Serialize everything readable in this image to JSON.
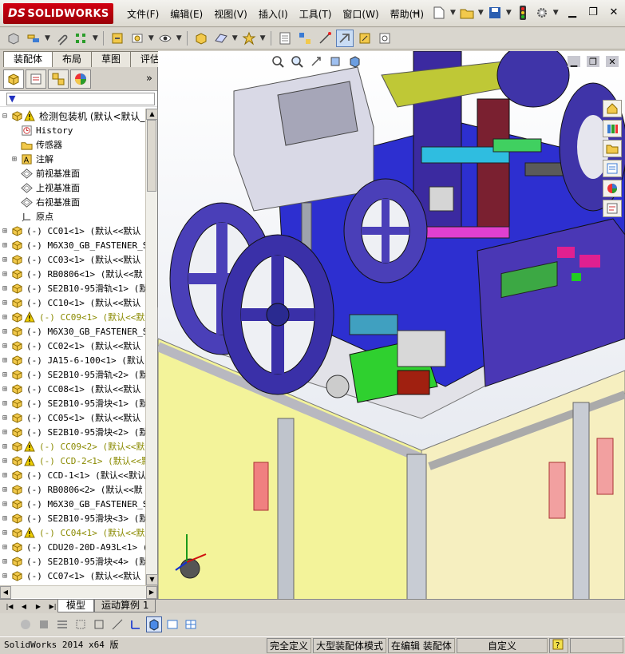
{
  "app": {
    "brand": "SOLIDWORKS",
    "brand_prefix": "DS"
  },
  "menu": {
    "items": [
      "文件(F)",
      "编辑(E)",
      "视图(V)",
      "插入(I)",
      "工具(T)",
      "窗口(W)",
      "帮助(H)"
    ],
    "pin": "⊣"
  },
  "tabs": [
    "装配体",
    "布局",
    "草图",
    "评估"
  ],
  "filter": {
    "placeholder": "▼"
  },
  "tree": {
    "root": "检测包装机  (默认<默认_显",
    "nodes": [
      {
        "label": "History",
        "icon": "history-icon"
      },
      {
        "label": "传感器",
        "icon": "sensor-icon"
      },
      {
        "label": "注解",
        "icon": "annotation-icon"
      },
      {
        "label": "前视基准面",
        "icon": "plane-icon"
      },
      {
        "label": "上视基准面",
        "icon": "plane-icon"
      },
      {
        "label": "右视基准面",
        "icon": "plane-icon"
      },
      {
        "label": "原点",
        "icon": "origin-icon"
      }
    ],
    "components": [
      {
        "label": "(-) CC01<1> (默认<<默认",
        "warn": false
      },
      {
        "label": "(-) M6X30_GB_FASTENER_S",
        "warn": false
      },
      {
        "label": "(-) CC03<1> (默认<<默认",
        "warn": false
      },
      {
        "label": "(-) RB0806<1> (默认<<默",
        "warn": false
      },
      {
        "label": "(-) SE2B10-95滑轨<1> (默",
        "warn": false
      },
      {
        "label": "(-) CC10<1> (默认<<默认",
        "warn": false
      },
      {
        "label": "(-) CC09<1> (默认<<默",
        "warn": true
      },
      {
        "label": "(-) M6X30_GB_FASTENER_S",
        "warn": false
      },
      {
        "label": "(-) CC02<1> (默认<<默认",
        "warn": false
      },
      {
        "label": "(-) JA15-6-100<1> (默认",
        "warn": false
      },
      {
        "label": "(-) SE2B10-95滑轨<2> (默",
        "warn": false
      },
      {
        "label": "(-) CC08<1> (默认<<默认",
        "warn": false
      },
      {
        "label": "(-) SE2B10-95滑块<1> (默",
        "warn": false
      },
      {
        "label": "(-) CC05<1> (默认<<默认",
        "warn": false
      },
      {
        "label": "(-) SE2B10-95滑块<2> (默",
        "warn": false
      },
      {
        "label": "(-) CC09<2> (默认<<默",
        "warn": true
      },
      {
        "label": "(-) CCD-2<1> (默认<<默",
        "warn": true
      },
      {
        "label": "(-) CCD-1<1> (默认<<默认",
        "warn": false
      },
      {
        "label": "(-) RB0806<2> (默认<<默",
        "warn": false
      },
      {
        "label": "(-) M6X30_GB_FASTENER_S",
        "warn": false
      },
      {
        "label": "(-) SE2B10-95滑块<3> (默",
        "warn": false
      },
      {
        "label": "(-) CC04<1> (默认<<默",
        "warn": true
      },
      {
        "label": "(-) CDU20-20D-A93L<1> (",
        "warn": false
      },
      {
        "label": "(-) SE2B10-95滑块<4> (默",
        "warn": false
      },
      {
        "label": "(-) CC07<1> (默认<<默认",
        "warn": false
      }
    ]
  },
  "bottom_tabs": [
    "模型",
    "运动算例 1"
  ],
  "status": {
    "version": "SolidWorks 2014 x64 版",
    "constraint": "完全定义",
    "mode": "大型装配体模式",
    "editing": "在编辑 装配体",
    "units": "自定义"
  },
  "colors": {
    "brand_red": "#c00010",
    "warning": "#e6c800",
    "component_yellow": "#f0d000"
  }
}
